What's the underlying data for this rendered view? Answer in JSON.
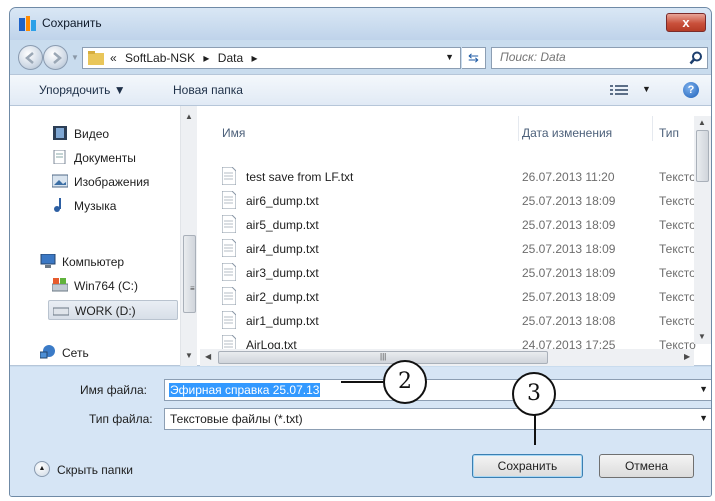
{
  "window": {
    "title": "Сохранить",
    "close_label": "x"
  },
  "address": {
    "crumbs": [
      "«",
      "SoftLab-NSK",
      "▸",
      "Data",
      "▸"
    ]
  },
  "search": {
    "placeholder": "Поиск: Data"
  },
  "toolbar": {
    "organize_label": "Упорядочить ▼",
    "new_folder_label": "Новая папка"
  },
  "nav": {
    "items": [
      {
        "label": "Видео",
        "icon": "video-icon"
      },
      {
        "label": "Документы",
        "icon": "documents-icon"
      },
      {
        "label": "Изображения",
        "icon": "pictures-icon"
      },
      {
        "label": "Музыка",
        "icon": "music-icon"
      },
      {
        "label": "Компьютер",
        "icon": "computer-icon"
      },
      {
        "label": "Win764 (C:)",
        "icon": "drive-icon"
      },
      {
        "label": "WORK (D:)",
        "icon": "drive-icon"
      },
      {
        "label": "Сеть",
        "icon": "network-icon"
      }
    ]
  },
  "files": {
    "columns": [
      "Имя",
      "Дата изменения",
      "Тип"
    ],
    "rows": [
      {
        "name": "test save from LF.txt",
        "date": "26.07.2013 11:20",
        "type": "Тексто"
      },
      {
        "name": "air6_dump.txt",
        "date": "25.07.2013 18:09",
        "type": "Тексто"
      },
      {
        "name": "air5_dump.txt",
        "date": "25.07.2013 18:09",
        "type": "Тексто"
      },
      {
        "name": "air4_dump.txt",
        "date": "25.07.2013 18:09",
        "type": "Тексто"
      },
      {
        "name": "air3_dump.txt",
        "date": "25.07.2013 18:09",
        "type": "Тексто"
      },
      {
        "name": "air2_dump.txt",
        "date": "25.07.2013 18:09",
        "type": "Тексто"
      },
      {
        "name": "air1_dump.txt",
        "date": "25.07.2013 18:08",
        "type": "Тексто"
      },
      {
        "name": "AirLog.txt",
        "date": "24.07.2013 17:25",
        "type": "Тексто"
      }
    ]
  },
  "form": {
    "filename_label": "Имя файла:",
    "filename_value": "Эфирная справка 25.07.13",
    "filetype_label": "Тип файла:",
    "filetype_value": "Текстовые файлы (*.txt)",
    "hide_folders_label": "Скрыть папки",
    "save_label": "Сохранить",
    "cancel_label": "Отмена"
  },
  "callouts": {
    "two": "2",
    "three": "3"
  }
}
